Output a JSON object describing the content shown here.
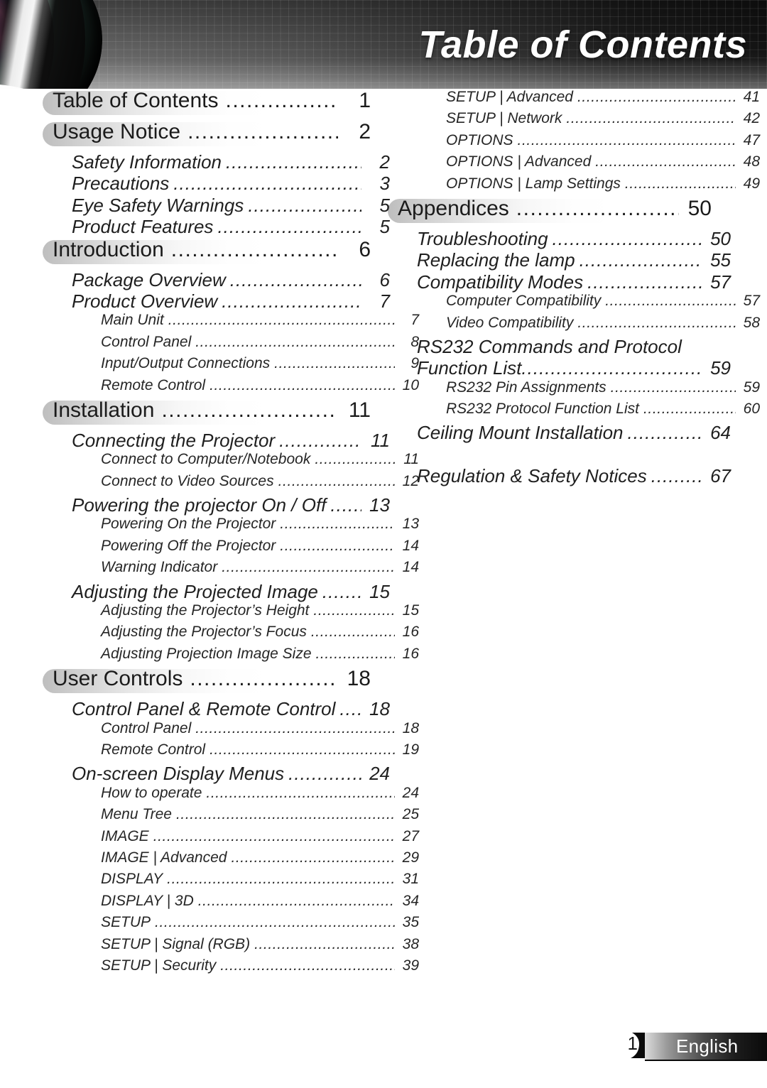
{
  "header": {
    "title": "Table of Contents",
    "lens_icon": "camera-lens-artwork"
  },
  "footer": {
    "page_number": "1",
    "language": "English"
  },
  "toc": {
    "left_column": [
      {
        "level": 1,
        "label": "Table of Contents",
        "page": "1"
      },
      {
        "level": 1,
        "label": "Usage Notice",
        "page": "2"
      },
      {
        "level": 2,
        "label": "Safety Information",
        "page": "2"
      },
      {
        "level": 2,
        "label": "Precautions",
        "page": "3"
      },
      {
        "level": 2,
        "label": "Eye Safety Warnings",
        "page": "5"
      },
      {
        "level": 2,
        "label": "Product Features",
        "page": "5"
      },
      {
        "level": 1,
        "label": "Introduction",
        "page": "6"
      },
      {
        "level": 2,
        "label": "Package Overview",
        "page": "6"
      },
      {
        "level": 2,
        "label": "Product Overview",
        "page": "7"
      },
      {
        "level": 3,
        "label": "Main Unit",
        "page": "7"
      },
      {
        "level": 3,
        "label": "Control Panel",
        "page": "8"
      },
      {
        "level": 3,
        "label": "Input/Output Connections",
        "page": "9"
      },
      {
        "level": 3,
        "label": "Remote Control",
        "page": "10"
      },
      {
        "level": 1,
        "label": "Installation",
        "page": "11"
      },
      {
        "level": 2,
        "label": "Connecting the Projector",
        "page": "11"
      },
      {
        "level": 3,
        "label": "Connect to Computer/Notebook",
        "page": "11"
      },
      {
        "level": 3,
        "label": "Connect to Video Sources",
        "page": "12"
      },
      {
        "level": 2,
        "label": "Powering the projector On / Off",
        "page": "13"
      },
      {
        "level": 3,
        "label": "Powering On the Projector",
        "page": "13"
      },
      {
        "level": 3,
        "label": "Powering Off the Projector",
        "page": "14"
      },
      {
        "level": 3,
        "label": "Warning Indicator",
        "page": "14"
      },
      {
        "level": 2,
        "label": "Adjusting the Projected Image",
        "page": "15"
      },
      {
        "level": 3,
        "label": "Adjusting the Projector’s Height",
        "page": "15"
      },
      {
        "level": 3,
        "label": "Adjusting the Projector’s Focus",
        "page": "16"
      },
      {
        "level": 3,
        "label": "Adjusting Projection Image Size",
        "page": "16"
      },
      {
        "level": 1,
        "label": "User Controls",
        "page": "18"
      },
      {
        "level": 2,
        "label": "Control Panel & Remote Control",
        "page": "18"
      },
      {
        "level": 3,
        "label": "Control Panel",
        "page": "18"
      },
      {
        "level": 3,
        "label": "Remote Control",
        "page": "19"
      },
      {
        "level": 2,
        "label": "On-screen Display Menus",
        "page": "24"
      },
      {
        "level": 3,
        "label": "How to operate",
        "page": "24"
      },
      {
        "level": 3,
        "label": "Menu Tree",
        "page": "25"
      },
      {
        "level": 3,
        "label": "IMAGE",
        "page": "27"
      },
      {
        "level": 3,
        "label": "IMAGE | Advanced",
        "page": "29"
      },
      {
        "level": 3,
        "label": "DISPLAY",
        "page": "31"
      },
      {
        "level": 3,
        "label": "DISPLAY | 3D",
        "page": "34"
      },
      {
        "level": 3,
        "label": "SETUP",
        "page": "35"
      },
      {
        "level": 3,
        "label": "SETUP | Signal (RGB)",
        "page": "38"
      },
      {
        "level": 3,
        "label": "SETUP | Security",
        "page": "39"
      }
    ],
    "right_column": [
      {
        "level": 3,
        "label": "SETUP | Advanced",
        "page": "41"
      },
      {
        "level": 3,
        "label": "SETUP | Network",
        "page": "42"
      },
      {
        "level": 3,
        "label": "OPTIONS",
        "page": "47"
      },
      {
        "level": 3,
        "label": "OPTIONS | Advanced",
        "page": "48"
      },
      {
        "level": 3,
        "label": "OPTIONS | Lamp Settings",
        "page": "49"
      },
      {
        "level": 1,
        "label": "Appendices",
        "page": "50"
      },
      {
        "level": 2,
        "label": "Troubleshooting",
        "page": "50"
      },
      {
        "level": 2,
        "label": "Replacing the lamp",
        "page": "55"
      },
      {
        "level": 2,
        "label": "Compatibility Modes",
        "page": "57"
      },
      {
        "level": 3,
        "label": "Computer Compatibility",
        "page": "57"
      },
      {
        "level": 3,
        "label": "Video Compatibility",
        "page": "58"
      },
      {
        "level": 2,
        "label": "RS232 Commands and Protocol",
        "label_line2": "Function List",
        "page": "59",
        "wrap": true
      },
      {
        "level": 3,
        "label": "RS232 Pin Assignments",
        "page": "59"
      },
      {
        "level": 3,
        "label": "RS232 Protocol Function List",
        "page": "60"
      },
      {
        "level": 2,
        "label": "Ceiling Mount Installation",
        "page": "64"
      },
      {
        "level": 0,
        "label": "",
        "page": "",
        "spacer": true
      },
      {
        "level": 2,
        "label": "Regulation & Safety Notices",
        "page": "67"
      }
    ]
  },
  "colors": {
    "header_dark": "#151515",
    "header_light": "#7a7a7a",
    "text": "#1b1b1b",
    "pill": "#969696",
    "footer_bar_dark": "#0a0a0a",
    "footer_bar_light": "#dcdcdc"
  }
}
